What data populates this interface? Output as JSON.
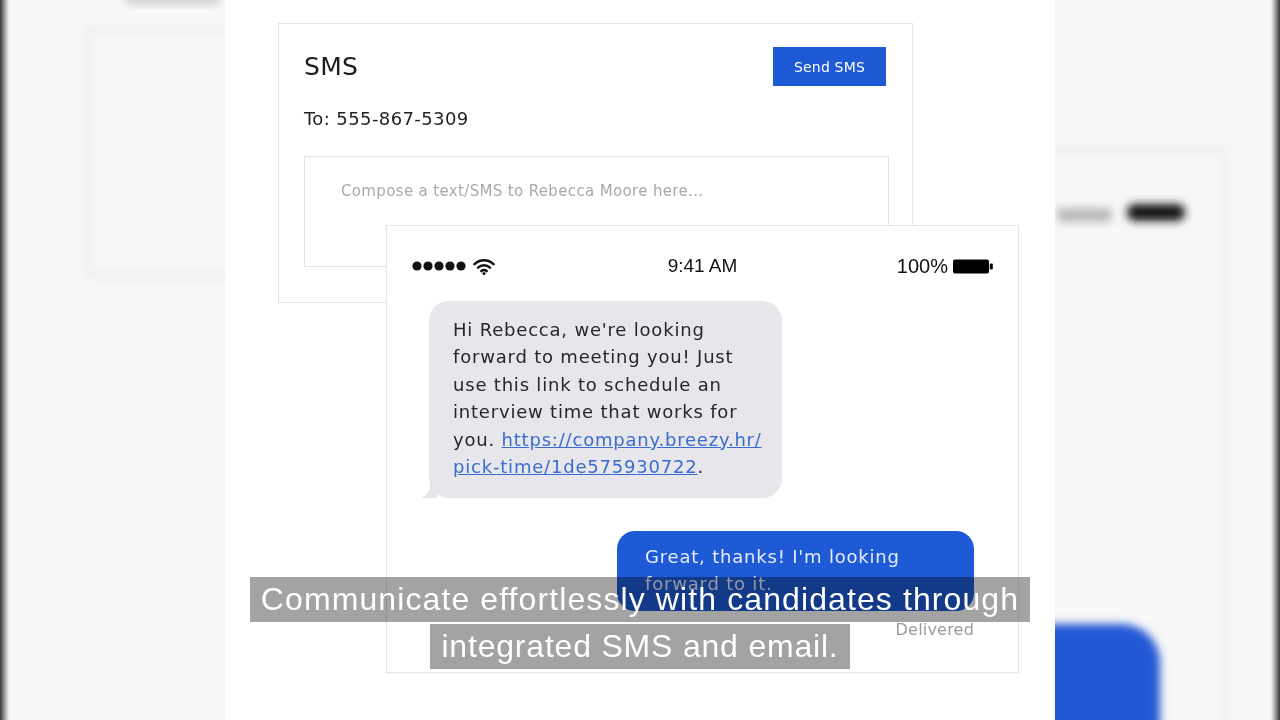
{
  "sms_panel": {
    "title": "SMS",
    "send_button": "Send SMS",
    "to_line": "To: 555-867-5309",
    "compose": {
      "placeholder": "Compose a text/SMS to Rebecca Moore here..."
    }
  },
  "phone": {
    "status_bar": {
      "time": "9:41 AM",
      "battery": "100%"
    },
    "messages": [
      {
        "kind": "received",
        "text": "Hi Rebecca, we're looking forward to meeting you! Just use this link to schedule an interview time that works for you.",
        "link_parts": [
          "https://company.breezy.hr/",
          "pick-time/1de575930722"
        ],
        "text_after": "."
      },
      {
        "kind": "sent",
        "text": "Great, thanks! I'm looking forward to it.",
        "status": "Delivered"
      }
    ]
  },
  "caption_lines": [
    "Communicate effortlessly with candidates through",
    "integrated SMS and email."
  ]
}
